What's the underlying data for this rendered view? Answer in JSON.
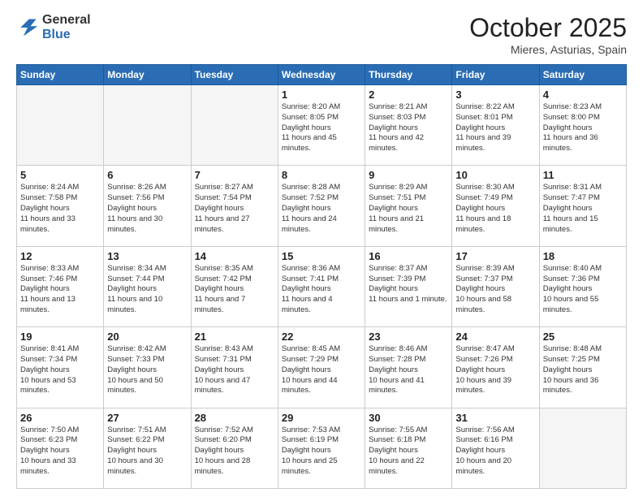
{
  "logo": {
    "general": "General",
    "blue": "Blue"
  },
  "header": {
    "month": "October 2025",
    "location": "Mieres, Asturias, Spain"
  },
  "weekdays": [
    "Sunday",
    "Monday",
    "Tuesday",
    "Wednesday",
    "Thursday",
    "Friday",
    "Saturday"
  ],
  "weeks": [
    [
      {
        "day": "",
        "empty": true
      },
      {
        "day": "",
        "empty": true
      },
      {
        "day": "",
        "empty": true
      },
      {
        "day": "1",
        "sunrise": "8:20 AM",
        "sunset": "8:05 PM",
        "daylight": "11 hours and 45 minutes."
      },
      {
        "day": "2",
        "sunrise": "8:21 AM",
        "sunset": "8:03 PM",
        "daylight": "11 hours and 42 minutes."
      },
      {
        "day": "3",
        "sunrise": "8:22 AM",
        "sunset": "8:01 PM",
        "daylight": "11 hours and 39 minutes."
      },
      {
        "day": "4",
        "sunrise": "8:23 AM",
        "sunset": "8:00 PM",
        "daylight": "11 hours and 36 minutes."
      }
    ],
    [
      {
        "day": "5",
        "sunrise": "8:24 AM",
        "sunset": "7:58 PM",
        "daylight": "11 hours and 33 minutes."
      },
      {
        "day": "6",
        "sunrise": "8:26 AM",
        "sunset": "7:56 PM",
        "daylight": "11 hours and 30 minutes."
      },
      {
        "day": "7",
        "sunrise": "8:27 AM",
        "sunset": "7:54 PM",
        "daylight": "11 hours and 27 minutes."
      },
      {
        "day": "8",
        "sunrise": "8:28 AM",
        "sunset": "7:52 PM",
        "daylight": "11 hours and 24 minutes."
      },
      {
        "day": "9",
        "sunrise": "8:29 AM",
        "sunset": "7:51 PM",
        "daylight": "11 hours and 21 minutes."
      },
      {
        "day": "10",
        "sunrise": "8:30 AM",
        "sunset": "7:49 PM",
        "daylight": "11 hours and 18 minutes."
      },
      {
        "day": "11",
        "sunrise": "8:31 AM",
        "sunset": "7:47 PM",
        "daylight": "11 hours and 15 minutes."
      }
    ],
    [
      {
        "day": "12",
        "sunrise": "8:33 AM",
        "sunset": "7:46 PM",
        "daylight": "11 hours and 13 minutes."
      },
      {
        "day": "13",
        "sunrise": "8:34 AM",
        "sunset": "7:44 PM",
        "daylight": "11 hours and 10 minutes."
      },
      {
        "day": "14",
        "sunrise": "8:35 AM",
        "sunset": "7:42 PM",
        "daylight": "11 hours and 7 minutes."
      },
      {
        "day": "15",
        "sunrise": "8:36 AM",
        "sunset": "7:41 PM",
        "daylight": "11 hours and 4 minutes."
      },
      {
        "day": "16",
        "sunrise": "8:37 AM",
        "sunset": "7:39 PM",
        "daylight": "11 hours and 1 minute."
      },
      {
        "day": "17",
        "sunrise": "8:39 AM",
        "sunset": "7:37 PM",
        "daylight": "10 hours and 58 minutes."
      },
      {
        "day": "18",
        "sunrise": "8:40 AM",
        "sunset": "7:36 PM",
        "daylight": "10 hours and 55 minutes."
      }
    ],
    [
      {
        "day": "19",
        "sunrise": "8:41 AM",
        "sunset": "7:34 PM",
        "daylight": "10 hours and 53 minutes."
      },
      {
        "day": "20",
        "sunrise": "8:42 AM",
        "sunset": "7:33 PM",
        "daylight": "10 hours and 50 minutes."
      },
      {
        "day": "21",
        "sunrise": "8:43 AM",
        "sunset": "7:31 PM",
        "daylight": "10 hours and 47 minutes."
      },
      {
        "day": "22",
        "sunrise": "8:45 AM",
        "sunset": "7:29 PM",
        "daylight": "10 hours and 44 minutes."
      },
      {
        "day": "23",
        "sunrise": "8:46 AM",
        "sunset": "7:28 PM",
        "daylight": "10 hours and 41 minutes."
      },
      {
        "day": "24",
        "sunrise": "8:47 AM",
        "sunset": "7:26 PM",
        "daylight": "10 hours and 39 minutes."
      },
      {
        "day": "25",
        "sunrise": "8:48 AM",
        "sunset": "7:25 PM",
        "daylight": "10 hours and 36 minutes."
      }
    ],
    [
      {
        "day": "26",
        "sunrise": "7:50 AM",
        "sunset": "6:23 PM",
        "daylight": "10 hours and 33 minutes."
      },
      {
        "day": "27",
        "sunrise": "7:51 AM",
        "sunset": "6:22 PM",
        "daylight": "10 hours and 30 minutes."
      },
      {
        "day": "28",
        "sunrise": "7:52 AM",
        "sunset": "6:20 PM",
        "daylight": "10 hours and 28 minutes."
      },
      {
        "day": "29",
        "sunrise": "7:53 AM",
        "sunset": "6:19 PM",
        "daylight": "10 hours and 25 minutes."
      },
      {
        "day": "30",
        "sunrise": "7:55 AM",
        "sunset": "6:18 PM",
        "daylight": "10 hours and 22 minutes."
      },
      {
        "day": "31",
        "sunrise": "7:56 AM",
        "sunset": "6:16 PM",
        "daylight": "10 hours and 20 minutes."
      },
      {
        "day": "",
        "empty": true
      }
    ]
  ]
}
